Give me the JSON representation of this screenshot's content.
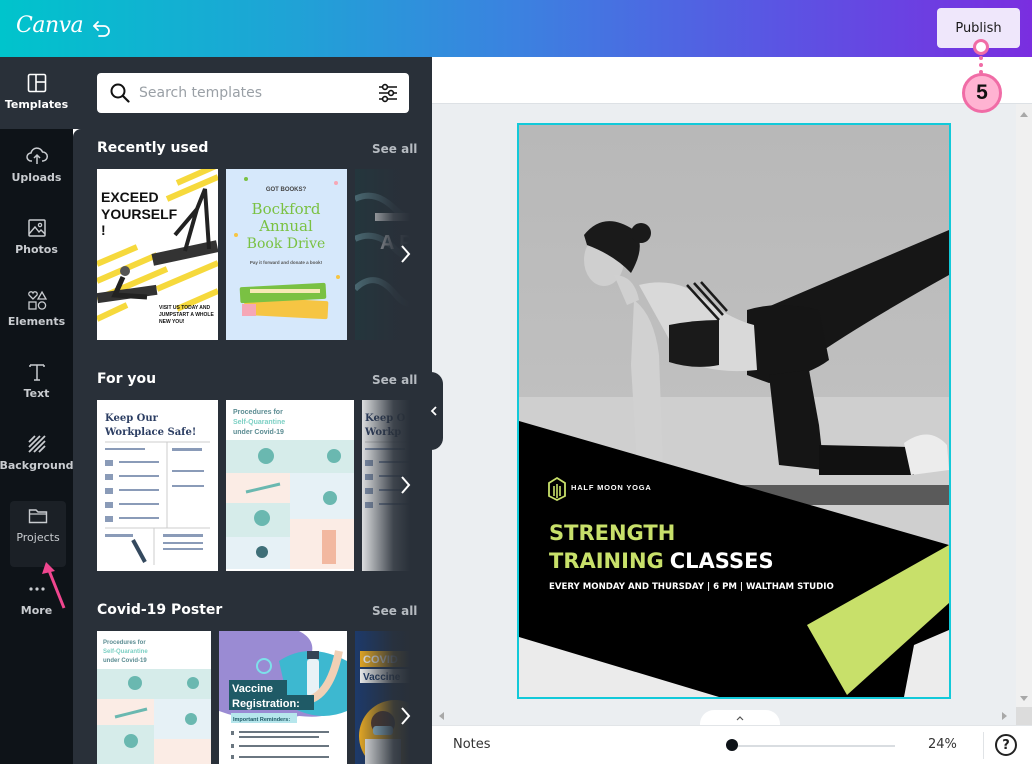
{
  "app": {
    "logo": "Canva"
  },
  "topbar": {
    "publish_label": "Publish"
  },
  "annotation": {
    "step_number": "5",
    "marker_color": "#f06ca6",
    "badge_fill": "#ffb3d2"
  },
  "rail": {
    "items": [
      {
        "label": "Templates",
        "icon": "templates-icon",
        "active": true
      },
      {
        "label": "Uploads",
        "icon": "upload-cloud-icon"
      },
      {
        "label": "Photos",
        "icon": "photo-icon"
      },
      {
        "label": "Elements",
        "icon": "shapes-icon"
      },
      {
        "label": "Text",
        "icon": "text-icon"
      },
      {
        "label": "Background",
        "icon": "hatch-icon"
      },
      {
        "label": "Projects",
        "icon": "folder-icon",
        "highlighted": true
      },
      {
        "label": "More",
        "icon": "more-dots-icon"
      }
    ]
  },
  "panel": {
    "search": {
      "placeholder": "Search templates",
      "value": ""
    },
    "sections": [
      {
        "title": "Recently used",
        "see_all": "See all",
        "templates": [
          {
            "name": "Exceed Yourself yoga poster",
            "headline": "EXCEED YOURSELF !",
            "subline": "VISIT US TODAY AND JUMPSTART A WHOLE NEW YOU!"
          },
          {
            "name": "Bockford Annual Book Drive poster",
            "kicker": "GOT BOOKS?",
            "headline": "Bockford Annual Book Drive",
            "subline": "Pay it forward and donate a book!"
          },
          {
            "name": "Dark ocean poster",
            "headline": "A P"
          }
        ]
      },
      {
        "title": "For you",
        "see_all": "See all",
        "templates": [
          {
            "name": "Keep Our Workplace Safe poster",
            "headline": "Keep Our Workplace Safe!"
          },
          {
            "name": "Procedures for Self-Quarantine poster",
            "headline": "Procedures for",
            "highlight": "Self-Quarantine",
            "tail": "under Covid-19"
          },
          {
            "name": "Keep Our Workplace Safe poster (variant)",
            "headline": "Keep O Workp"
          }
        ]
      },
      {
        "title": "Covid-19 Poster",
        "see_all": "See all",
        "templates": [
          {
            "name": "Procedures for Self-Quarantine poster",
            "headline": "Procedures for",
            "highlight": "Self-Quarantine",
            "tail": "under Covid-19"
          },
          {
            "name": "Vaccine Registration poster",
            "headline": "Vaccine Registration:",
            "subline": "Important Reminders:"
          },
          {
            "name": "COVID Vaccine poster",
            "headline": "COVID",
            "subline": "Vaccine"
          }
        ]
      }
    ]
  },
  "design": {
    "brand": "HALF MOON YOGA",
    "title_line1": "STRENGTH",
    "title_line2_accent": "TRAINING",
    "title_line2_rest": "CLASSES",
    "schedule": "EVERY MONDAY AND THURSDAY | 6 PM | WALTHAM STUDIO",
    "accent_color": "#c8e06a",
    "selection_color": "#12c9d9"
  },
  "footer": {
    "notes_label": "Notes",
    "zoom_percent_label": "24%",
    "zoom_percent": 24,
    "help_label": "?"
  }
}
